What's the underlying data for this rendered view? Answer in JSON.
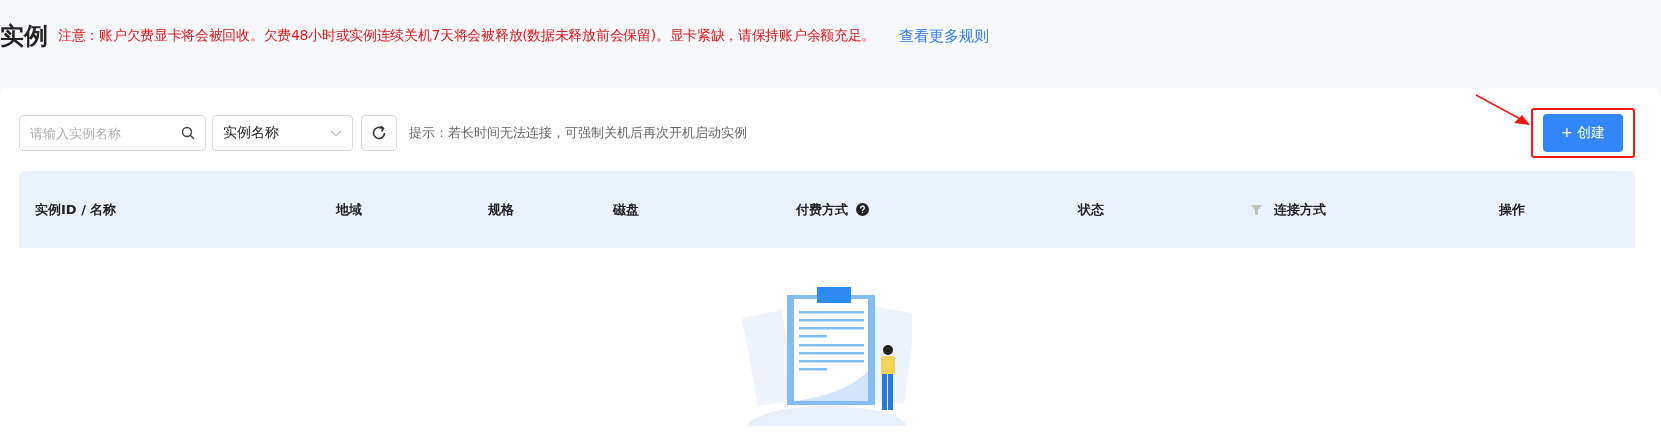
{
  "page": {
    "title": "实例",
    "notice": "注意：账户欠费显卡将会被回收。欠费48小时或实例连续关机7天将会被释放(数据未释放前会保留)。显卡紧缺，请保持账户余额充足。",
    "rules_link": "查看更多规则"
  },
  "toolbar": {
    "search": {
      "placeholder": "请输入实例名称"
    },
    "filter_select": {
      "value": "实例名称"
    },
    "hint": "提示：若长时间无法连接，可强制关机后再次开机启动实例",
    "create_button": "+ 创建"
  },
  "table": {
    "columns": [
      {
        "label": "实例ID / 名称",
        "kind": "plain"
      },
      {
        "label": "地域",
        "kind": "plain"
      },
      {
        "label": "规格",
        "kind": "plain"
      },
      {
        "label": "磁盘",
        "kind": "plain"
      },
      {
        "label": "付费方式",
        "kind": "help"
      },
      {
        "label": "状态",
        "kind": "filter"
      },
      {
        "label": "连接方式",
        "kind": "plain"
      },
      {
        "label": "操作",
        "kind": "plain"
      }
    ]
  }
}
